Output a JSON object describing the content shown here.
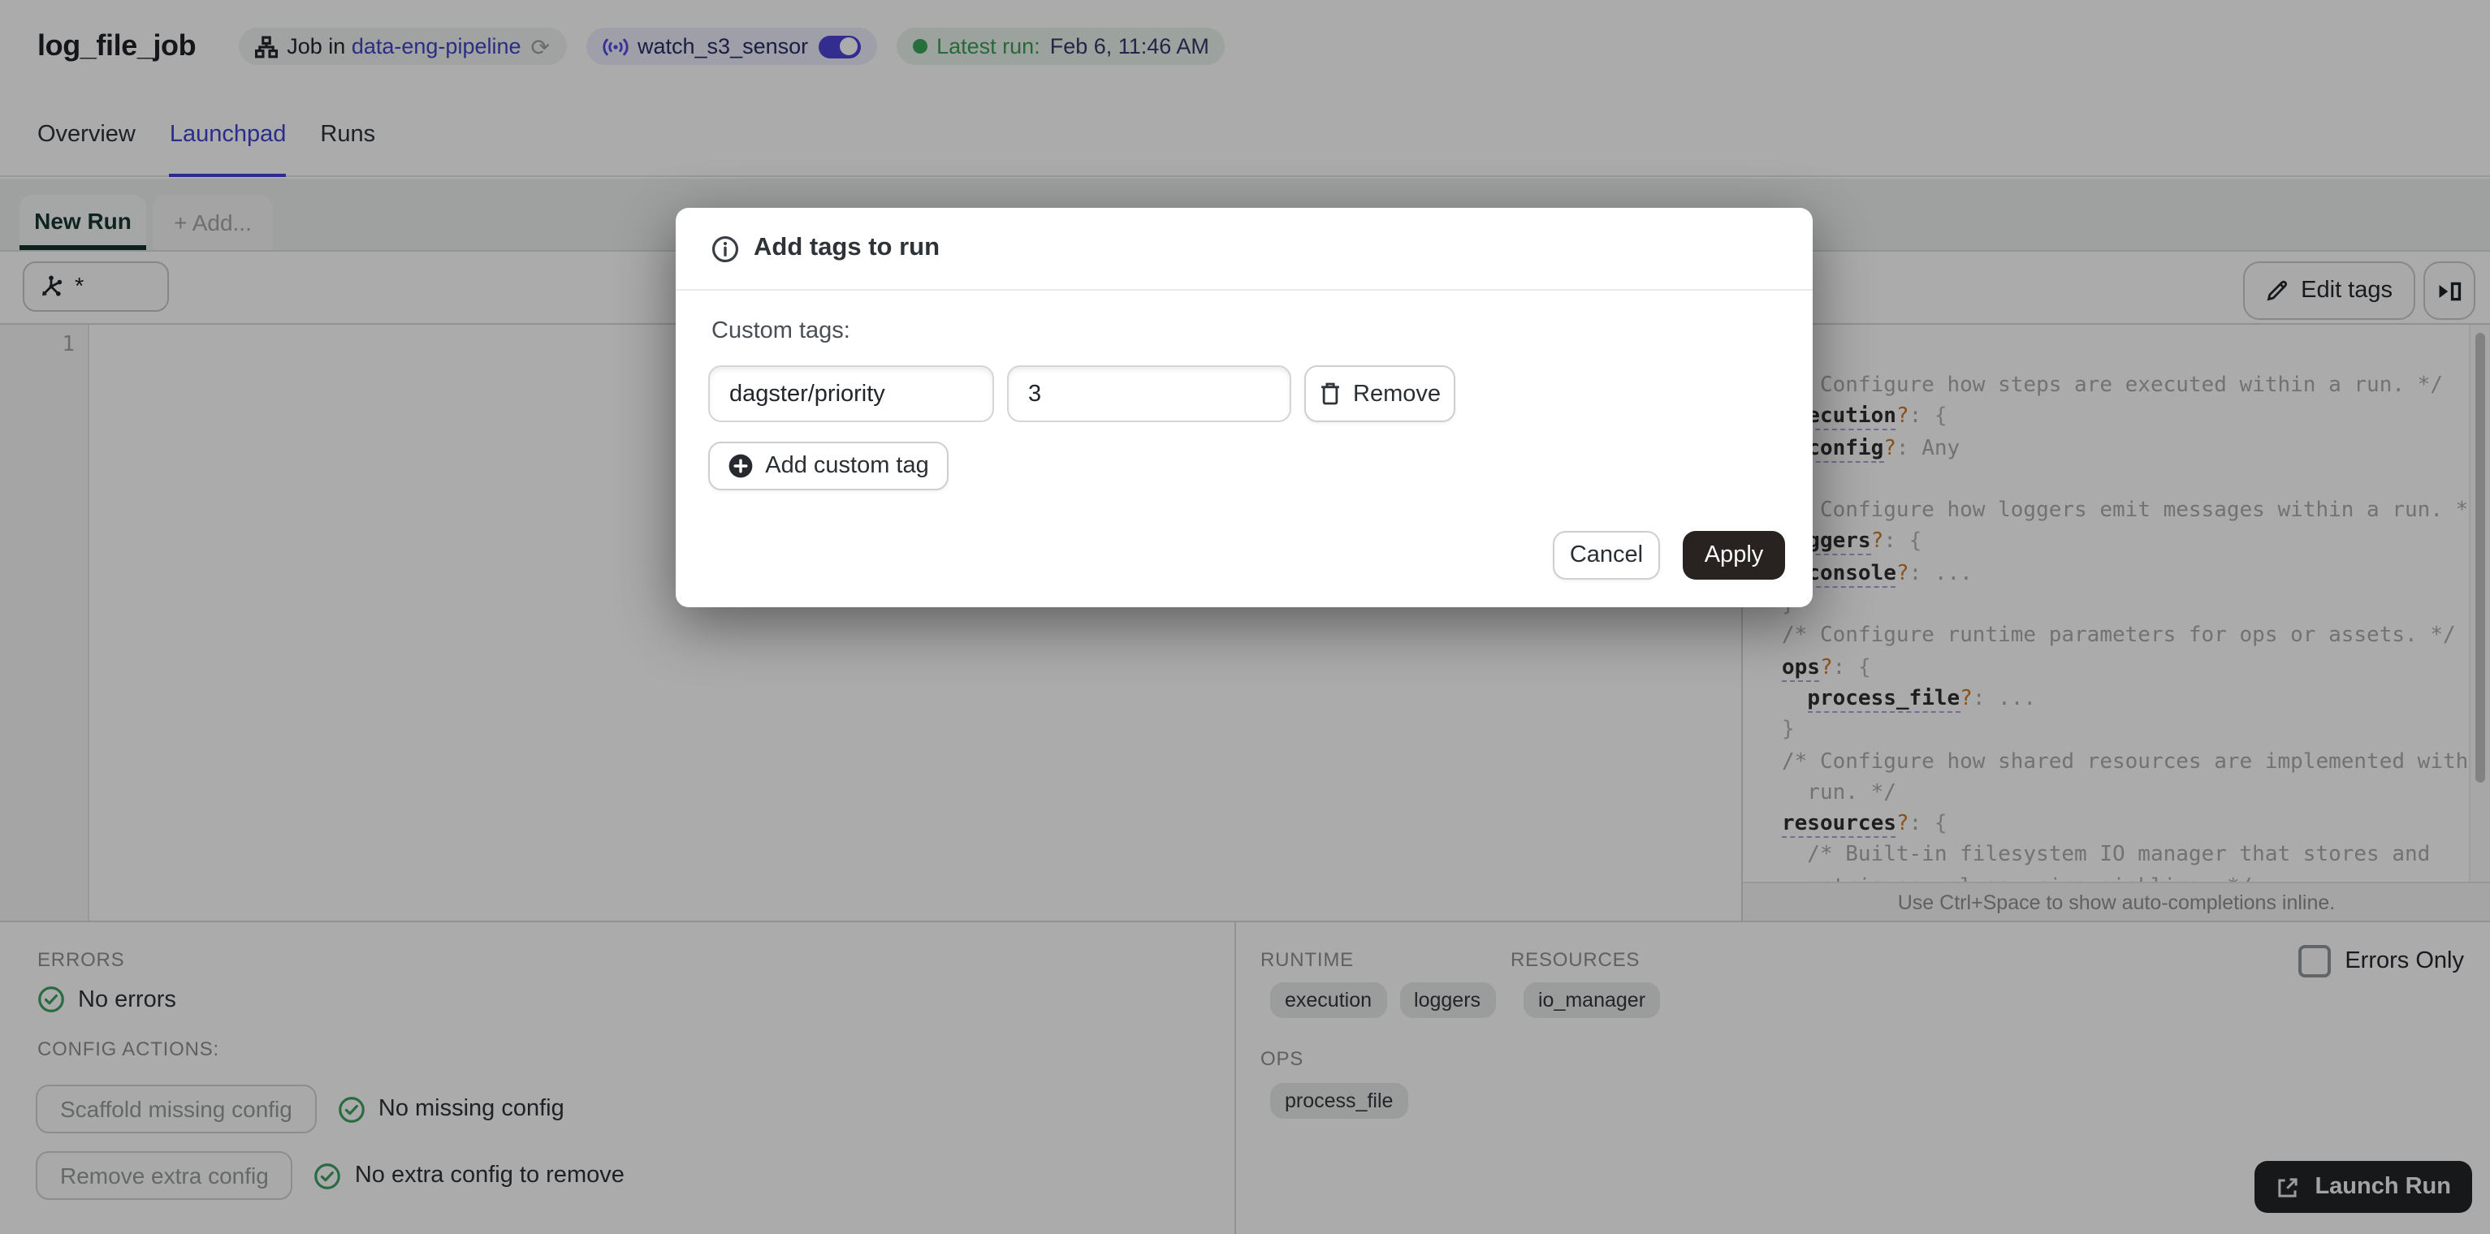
{
  "colors": {
    "accent_indigo": "#3f43d0",
    "link_blue": "#3f45c4",
    "sensor_indigo": "#5149e0",
    "green": "#3ba45c",
    "green_text": "#3d9c55",
    "orange_token": "#c97a2a",
    "dark_green_tab": "#14322c",
    "apply_button_bg": "#282320",
    "launch_button_bg": "#222527"
  },
  "header": {
    "title": "log_file_job",
    "job_tag": {
      "prefix": "Job in",
      "link": "data-eng-pipeline"
    },
    "sensor_tag": {
      "label": "watch_s3_sensor",
      "state": "on"
    },
    "latest_run": {
      "label": "Latest run:",
      "value": "Feb 6, 11:46 AM"
    }
  },
  "tabs": [
    {
      "label": "Overview",
      "active": false
    },
    {
      "label": "Launchpad",
      "active": true
    },
    {
      "label": "Runs",
      "active": false
    }
  ],
  "launchpad": {
    "run_tabs": {
      "new_run": "New Run",
      "add": "+ Add..."
    },
    "op_filter_value": "*",
    "editor_first_line_number": "1",
    "edit_tags_label": "Edit tags"
  },
  "dialog": {
    "title": "Add tags to run",
    "section_label": "Custom tags:",
    "tag_key": "dagster/priority",
    "tag_value": "3",
    "remove_label": "Remove",
    "add_label": "Add custom tag",
    "cancel_label": "Cancel",
    "apply_label": "Apply"
  },
  "schema_panel": {
    "hint": "Use Ctrl+Space to show auto-completions inline.",
    "code_lines": [
      [
        {
          "s": "c",
          "t": "/* Configure how steps are executed within a run. */"
        }
      ],
      [
        {
          "s": "k",
          "t": "execution"
        },
        {
          "s": "q",
          "t": "?"
        },
        {
          "s": "p",
          "t": ": "
        },
        {
          "s": "b",
          "t": "{"
        }
      ],
      [
        {
          "s": "p",
          "t": "  "
        },
        {
          "s": "k",
          "t": "config"
        },
        {
          "s": "q",
          "t": "?"
        },
        {
          "s": "p",
          "t": ": "
        },
        {
          "s": "v",
          "t": "Any"
        }
      ],
      [
        {
          "s": "b",
          "t": "}"
        }
      ],
      [
        {
          "s": "c",
          "t": "/* Configure how loggers emit messages within a run. */"
        }
      ],
      [
        {
          "s": "k",
          "t": "loggers"
        },
        {
          "s": "q",
          "t": "?"
        },
        {
          "s": "p",
          "t": ": "
        },
        {
          "s": "b",
          "t": "{"
        }
      ],
      [
        {
          "s": "p",
          "t": "  "
        },
        {
          "s": "k",
          "t": "console"
        },
        {
          "s": "q",
          "t": "?"
        },
        {
          "s": "p",
          "t": ": "
        },
        {
          "s": "v",
          "t": "..."
        }
      ],
      [
        {
          "s": "b",
          "t": "}"
        }
      ],
      [
        {
          "s": "c",
          "t": "/* Configure runtime parameters for ops or assets. */"
        }
      ],
      [
        {
          "s": "k",
          "t": "ops"
        },
        {
          "s": "q",
          "t": "?"
        },
        {
          "s": "p",
          "t": ": "
        },
        {
          "s": "b",
          "t": "{"
        }
      ],
      [
        {
          "s": "p",
          "t": "  "
        },
        {
          "s": "k",
          "t": "process_file"
        },
        {
          "s": "q",
          "t": "?"
        },
        {
          "s": "p",
          "t": ": "
        },
        {
          "s": "v",
          "t": "..."
        }
      ],
      [
        {
          "s": "b",
          "t": "}"
        }
      ],
      [
        {
          "s": "c",
          "t": "/* Configure how shared resources are implemented within a"
        }
      ],
      [
        {
          "s": "c",
          "t": "  run. */"
        }
      ],
      [
        {
          "s": "k",
          "t": "resources"
        },
        {
          "s": "q",
          "t": "?"
        },
        {
          "s": "p",
          "t": ": "
        },
        {
          "s": "b",
          "t": "{"
        }
      ],
      [
        {
          "s": "c",
          "t": "  /* Built-in filesystem IO manager that stores and"
        }
      ],
      [
        {
          "s": "c",
          "t": "  retrieves values using pickling. */"
        }
      ]
    ]
  },
  "bottom": {
    "errors": {
      "heading": "ERRORS",
      "status": "No errors"
    },
    "config_actions": {
      "heading": "CONFIG ACTIONS:",
      "rows": [
        {
          "button": "Scaffold missing config",
          "status": "No missing config"
        },
        {
          "button": "Remove extra config",
          "status": "No extra config to remove"
        }
      ]
    },
    "runtime": {
      "heading": "RUNTIME",
      "tags": [
        "execution",
        "loggers"
      ]
    },
    "resources": {
      "heading": "RESOURCES",
      "tags": [
        "io_manager"
      ]
    },
    "ops": {
      "heading": "OPS",
      "tags": [
        "process_file"
      ]
    },
    "errors_only_label": "Errors Only",
    "launch_label": "Launch Run"
  }
}
